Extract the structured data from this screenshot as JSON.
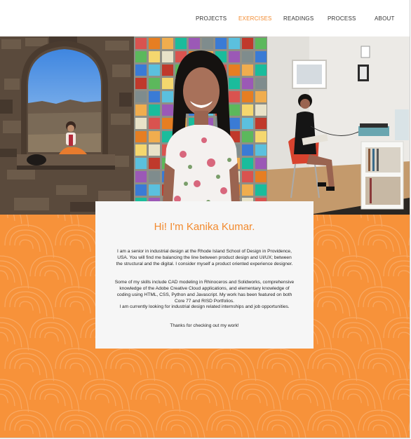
{
  "nav": {
    "items": [
      {
        "label": "PROJECTS",
        "active": false
      },
      {
        "label": "EXERCISES",
        "active": true
      },
      {
        "label": "READINGS",
        "active": false
      },
      {
        "label": "PROCESS",
        "active": false
      },
      {
        "label": "ABOUT",
        "active": false
      }
    ]
  },
  "photos": {
    "count": 3,
    "icons": [
      "fort-photo",
      "portrait-photo",
      "room-photo"
    ]
  },
  "intro": {
    "title": "Hi! I'm Kanika Kumar.",
    "paragraph1": "I am a senior in industrial design at the Rhode Island School of Design in Providence, USA. You will find me balancing the line between product design and UI/UX; between the structural and the digital. I consider myself a product oriented experience designer.",
    "paragraph2": "Some of my skills include CAD modeling in Rhinoceros and Solidworks, comprehensive knowledge of the Adobe Creative Cloud applications, and elementary knowledge of coding using HTML, CSS, Python and Javascript. My work has been featured on both Core 77 and RISD Portfolios.",
    "paragraph3": "I  am currently looking for industrial design related internships and job opportunities.",
    "paragraph4": "Thanks for checking out my work!"
  },
  "colors": {
    "accent": "#f28a2e",
    "pattern_base": "#f7923a",
    "pattern_line": "#f9b070",
    "card": "#f6f6f6"
  }
}
